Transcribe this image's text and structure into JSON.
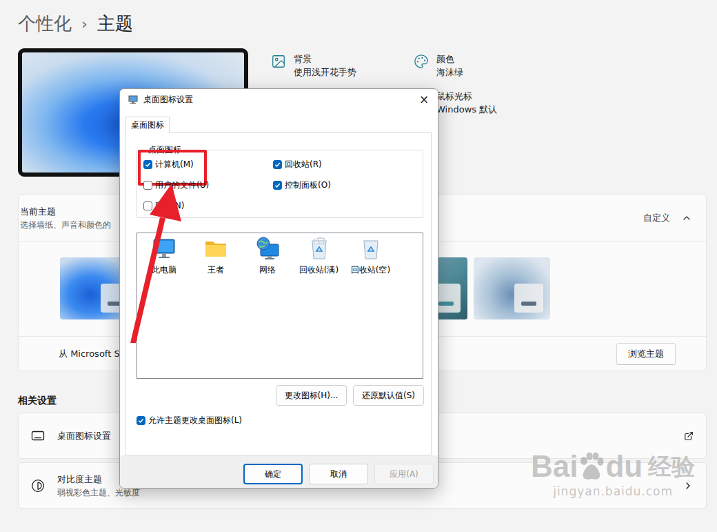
{
  "breadcrumb": {
    "parent": "个性化",
    "separator": "›",
    "current": "主题"
  },
  "theme_settings": [
    {
      "title": "背景",
      "value": "使用浅开花手势",
      "kind": "background"
    },
    {
      "title": "颜色",
      "value": "海沫绿",
      "kind": "color"
    },
    {
      "title": "鼠标光标",
      "value": "Windows 默认",
      "kind": "cursor"
    }
  ],
  "current_theme": {
    "title": "当前主题",
    "subtitle": "选择墙纸、声音和颜色的",
    "value": "自定义",
    "expanded": true,
    "store_text": "从 Microsoft S",
    "browse_button": "浏览主题"
  },
  "related": {
    "heading": "相关设置",
    "items": [
      {
        "title": "桌面图标设置",
        "subtitle": "",
        "kind": "link"
      },
      {
        "title": "对比度主题",
        "subtitle": "弱视彩色主题、光敏度",
        "kind": "nav"
      }
    ]
  },
  "dialog": {
    "title": "桌面图标设置",
    "close": "×",
    "tabs": [
      {
        "label": "桌面图标",
        "selected": true
      }
    ],
    "group_label": "桌面图标",
    "checkboxes": [
      {
        "label": "计算机(M)",
        "checked": true,
        "highlighted": true
      },
      {
        "label": "回收站(R)",
        "checked": true,
        "highlighted": false
      },
      {
        "label": "用户的文件(U)",
        "checked": false,
        "highlighted": false
      },
      {
        "label": "控制面板(O)",
        "checked": true,
        "highlighted": false
      },
      {
        "label": "网络(N)",
        "checked": false,
        "highlighted": false
      }
    ],
    "icons": [
      {
        "label": "此电脑",
        "kind": "computer",
        "selected": false
      },
      {
        "label": "王者",
        "kind": "folder",
        "selected": false
      },
      {
        "label": "网络",
        "kind": "network",
        "selected": false
      },
      {
        "label": "回收站(满)",
        "kind": "bin-full",
        "selected": false
      },
      {
        "label": "回收站(空)",
        "kind": "bin-empty",
        "selected": false
      }
    ],
    "icon_buttons": [
      "更改图标(H)...",
      "还原默认值(S)"
    ],
    "allow_themes": {
      "label": "允许主题更改桌面图标(L)",
      "checked": true
    },
    "buttons": [
      {
        "label": "确定",
        "default": true,
        "disabled": false
      },
      {
        "label": "取消",
        "default": false,
        "disabled": false
      },
      {
        "label": "应用(A)",
        "default": false,
        "disabled": true
      }
    ]
  },
  "watermark": {
    "brand_start": "Bai",
    "brand_end": "du",
    "label": "经验",
    "url": "jingyan.baidu.com"
  }
}
